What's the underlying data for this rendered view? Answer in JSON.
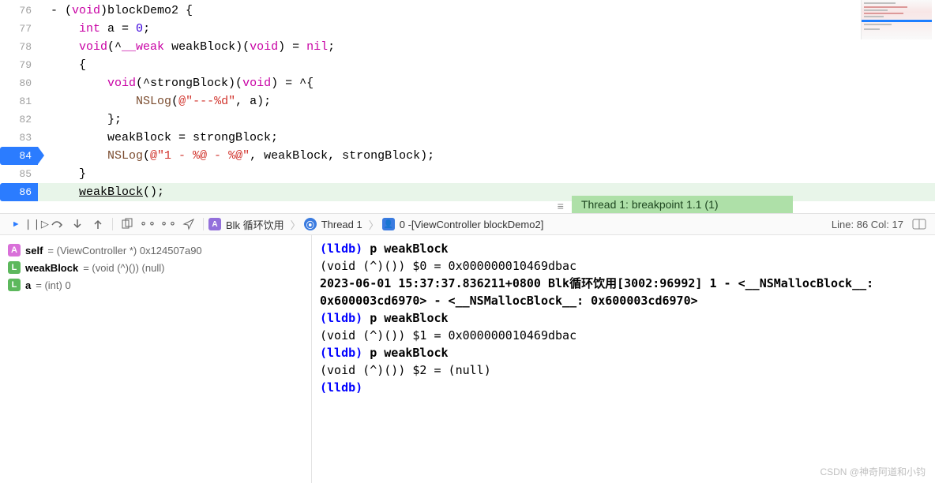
{
  "code": {
    "lines": [
      {
        "n": 76,
        "content": "- (void)blockDemo2 {"
      },
      {
        "n": 77,
        "content": "    int a = 0;"
      },
      {
        "n": 78,
        "content": "    void(^__weak weakBlock)(void) = nil;"
      },
      {
        "n": 79,
        "content": "    {"
      },
      {
        "n": 80,
        "content": "        void(^strongBlock)(void) = ^{"
      },
      {
        "n": 81,
        "content": "            NSLog(@\"---%d\", a);"
      },
      {
        "n": 82,
        "content": "        };"
      },
      {
        "n": 83,
        "content": "        weakBlock = strongBlock;"
      },
      {
        "n": 84,
        "content": "        NSLog(@\"1 - %@ - %@\", weakBlock, strongBlock);"
      },
      {
        "n": 85,
        "content": "    }"
      },
      {
        "n": 86,
        "content": "    weakBlock();"
      }
    ],
    "breakpoints": [
      84,
      86
    ],
    "current_line": 86
  },
  "thread_badge": "Thread 1: breakpoint 1.1 (1)",
  "toolbar": {
    "target": "Blk 循环饮用",
    "thread": "Thread 1",
    "frame": "0 -[ViewController blockDemo2]",
    "line_col": "Line: 86  Col: 17"
  },
  "variables": [
    {
      "badge": "A",
      "badgeClass": "a",
      "name": "self",
      "value": "= (ViewController *) 0x124507a90"
    },
    {
      "badge": "L",
      "badgeClass": "l",
      "name": "weakBlock",
      "value": "= (void (^)()) (null)"
    },
    {
      "badge": "L",
      "badgeClass": "l",
      "name": "a",
      "value": "= (int) 0"
    }
  ],
  "console": [
    {
      "prompt": "(lldb) ",
      "cmd": "p weakBlock"
    },
    {
      "text": "(void (^)()) $0 = 0x000000010469dbac"
    },
    {
      "bold": "2023-06-01 15:37:37.836211+0800 Blk循环饮用[3002:96992] 1 - <__NSMallocBlock__: 0x600003cd6970> - <__NSMallocBlock__: 0x600003cd6970>"
    },
    {
      "prompt": "(lldb) ",
      "cmd": "p weakBlock"
    },
    {
      "text": "(void (^)()) $1 = 0x000000010469dbac"
    },
    {
      "prompt": "(lldb) ",
      "cmd": "p weakBlock"
    },
    {
      "text": "(void (^)()) $2 = (null)"
    },
    {
      "prompt": "(lldb) ",
      "cmd": ""
    }
  ],
  "watermark": "CSDN @神奇阿道和小钧"
}
